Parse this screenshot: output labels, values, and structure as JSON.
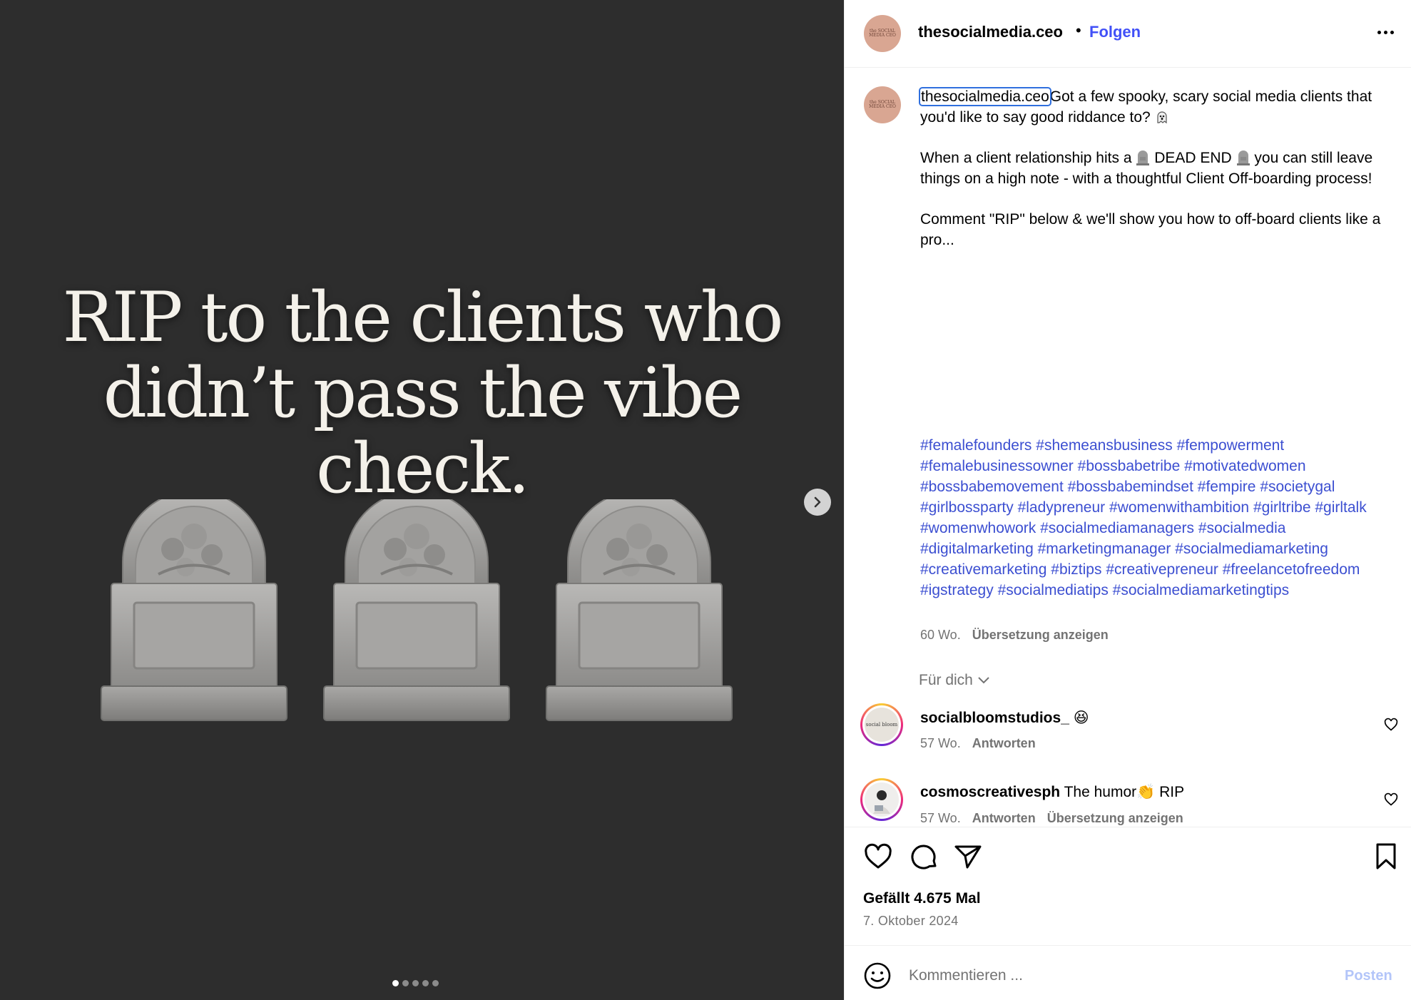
{
  "media": {
    "headline_lines": [
      "RIP to the clients who",
      "didn’t pass the vibe check."
    ],
    "carousel_dot_count": 5,
    "carousel_active_index": 0
  },
  "header": {
    "username": "thesocialmedia.ceo",
    "separator": "•",
    "follow_label": "Folgen",
    "avatar_text": "the SOCIAL MEDIA CEO"
  },
  "caption": {
    "username": "thesocialmedia.ceo",
    "line1": "Got a few spooky, scary social media clients that you'd like to say good riddance to?",
    "line2_before": "When a client relationship hits a",
    "line2_middle": "DEAD END",
    "line2_after": "you can still leave things on a high note - with a thoughtful Client Off-boarding process!",
    "line3": "Comment \"RIP\" below & we'll show you how to off-board clients like a pro...",
    "hashtags": [
      "#femalefounders",
      "#shemeansbusiness",
      "#fempowerment",
      "#femalebusinessowner",
      "#bossbabetribe",
      "#motivatedwomen",
      "#bossbabemovement",
      "#bossbabemindset",
      "#fempire",
      "#societygal",
      "#girlbossparty",
      "#ladypreneur",
      "#womenwithambition",
      "#girltribe",
      "#girltalk",
      "#womenwhowork",
      "#socialmediamanagers",
      "#socialmedia",
      "#digitalmarketing",
      "#marketingmanager",
      "#socialmediamarketing",
      "#creativemarketing",
      "#biztips",
      "#creativepreneur",
      "#freelancetofreedom",
      "#igstrategy",
      "#socialmediatips",
      "#socialmediamarketingtips"
    ],
    "age": "60 Wo.",
    "translate_label": "Übersetzung anzeigen"
  },
  "comments_filter": {
    "label": "Für dich"
  },
  "comments": [
    {
      "username": "socialbloomstudios_",
      "text": "😆",
      "age": "57 Wo.",
      "reply_label": "Antworten",
      "translate_label": "",
      "avatar_text": "social bloom"
    },
    {
      "username": "cosmoscreativesph",
      "text": "The humor👏 RIP",
      "age": "57 Wo.",
      "reply_label": "Antworten",
      "translate_label": "Übersetzung anzeigen",
      "avatar_text": ""
    }
  ],
  "actions": {
    "likes_text": "Gefällt 4.675 Mal",
    "date_text": "7. Oktober 2024"
  },
  "composer": {
    "placeholder": "Kommentieren ...",
    "post_label": "Posten"
  },
  "colors": {
    "media_background": "#2d2d2d",
    "link_blue": "#4150f7",
    "hashtag_blue": "#3c4fd1",
    "post_button_disabled": "#b3c5f9",
    "secondary_text": "#737373",
    "avatar_brand": "#d9a692"
  }
}
